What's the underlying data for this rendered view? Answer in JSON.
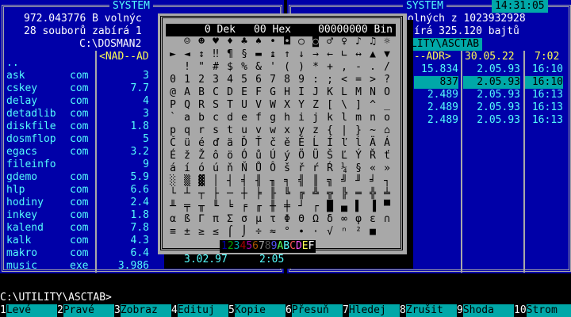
{
  "left_panel": {
    "title": "SYSTEM",
    "free_bytes": "972.043776 B volnýc",
    "used_line": "28 souborů zabírá 1",
    "path": "C:\\DOSMAN2",
    "column_header": "<NAD--AD",
    "files": [
      {
        "name": "..",
        "ext": "",
        "size": ""
      },
      {
        "name": "ask",
        "ext": "com",
        "size": "3"
      },
      {
        "name": "cskey",
        "ext": "com",
        "size": "7.7"
      },
      {
        "name": "delay",
        "ext": "com",
        "size": "4"
      },
      {
        "name": "detadlib",
        "ext": "com",
        "size": "3"
      },
      {
        "name": "diskfile",
        "ext": "com",
        "size": "1.8"
      },
      {
        "name": "dosmflop",
        "ext": "com",
        "size": "5"
      },
      {
        "name": "egacs",
        "ext": "com",
        "size": "3.2"
      },
      {
        "name": "fileinfo",
        "ext": "",
        "size": "9"
      },
      {
        "name": "gdemo",
        "ext": "com",
        "size": "5.9"
      },
      {
        "name": "hlp",
        "ext": "com",
        "size": "6.6"
      },
      {
        "name": "hodiny",
        "ext": "com",
        "size": "2.4"
      },
      {
        "name": "inkey",
        "ext": "com",
        "size": "1.8"
      },
      {
        "name": "kalend",
        "ext": "com",
        "size": "7.8"
      },
      {
        "name": "kalk",
        "ext": "com",
        "size": "4.3"
      },
      {
        "name": "makro",
        "ext": "com",
        "size": "6.4"
      },
      {
        "name": "music",
        "ext": "exe",
        "size": "3.986"
      }
    ],
    "music_date": "3.02.97",
    "music_time": "2:05"
  },
  "right_panel": {
    "title": "SYSTEM",
    "clock": "14:31:05",
    "free_line": "olných z 1023932928",
    "used_line": "bírá 325.120 bajtů",
    "path": "LITY\\ASCTAB",
    "col_header_name": "D--ADR>",
    "col_header_date": "30.05.22",
    "col_header_time": "7:02",
    "rows": [
      {
        "size": "15.834",
        "date": "2.05.93",
        "time": "16:10",
        "selected": false
      },
      {
        "size": "837",
        "date": "2.05.93",
        "time": "16:10",
        "selected": true
      },
      {
        "size": "2.489",
        "date": "2.05.93",
        "time": "16:13",
        "selected": false
      },
      {
        "size": "2.489",
        "date": "2.05.93",
        "time": "16:13",
        "selected": false
      },
      {
        "size": "2.489",
        "date": "2.05.93",
        "time": "16:13",
        "selected": false
      }
    ]
  },
  "asctab": {
    "dec_label": "0 Dek",
    "hex_label": "00 Hex",
    "bin_label": "00000000 Bin",
    "rows": [
      " ☺☻♥♦♣♠•◘○◙♂♀♪♫☼",
      "►◄↕‼¶§▬↨↑↓→←∟↔▲▼",
      " !\"#$%&'()*+,-./",
      "0123456789:;<=>?",
      "@ABCDEFGHIJKLMNO",
      "PQRSTUVWXYZ[\\]^_",
      "`abcdefghijklmno",
      "pqrstuvwxyz{|}~⌂",
      "ČüéďäĎŤčěĚĹÍľĺÄÁ",
      "ÉžŽôöÓůÚýÖÜŠĽÝŘť",
      "áíóúňŇŮÔšřŕŔ¼§«»",
      "░▒▓│┤╡╢╖╕╣║╗╝╜╛┐",
      "└┴┬├─┼╞╟╚╔╩╦╠═╬╧",
      "╨╤╥╙╘╒╓╫╪┘┌█▄▌▐▀",
      "αßΓπΣσµτΦΘΩδ∞φε∩",
      "≡±≥≤⌠⌡÷≈°∙·√ⁿ²■ "
    ],
    "color_strip": [
      "1",
      "2",
      "3",
      "4",
      "5",
      "6",
      "7",
      "8",
      "9",
      "A",
      "B",
      "C",
      "D",
      "E",
      "F"
    ],
    "strip_colors": [
      "#0000a8",
      "#00a800",
      "#00a8a8",
      "#a80000",
      "#a800a8",
      "#a85400",
      "#a8a8a8",
      "#545454",
      "#5454fc",
      "#54fc54",
      "#54fcfc",
      "#fc5454",
      "#fc54fc",
      "#fcfc54",
      "#ffffff"
    ]
  },
  "command_line": "C:\\UTILITY\\ASCTAB>",
  "fkeys": [
    {
      "num": "1",
      "label": "Levé"
    },
    {
      "num": "2",
      "label": "Pravé"
    },
    {
      "num": "3",
      "label": "Zobraz"
    },
    {
      "num": "4",
      "label": "Edituj"
    },
    {
      "num": "5",
      "label": "Kopie"
    },
    {
      "num": "6",
      "label": "Přesuň"
    },
    {
      "num": "7",
      "label": "Hledej"
    },
    {
      "num": "8",
      "label": "Zrušit"
    },
    {
      "num": "9",
      "label": "Shoda"
    },
    {
      "num": "10",
      "label": "Strom"
    }
  ]
}
